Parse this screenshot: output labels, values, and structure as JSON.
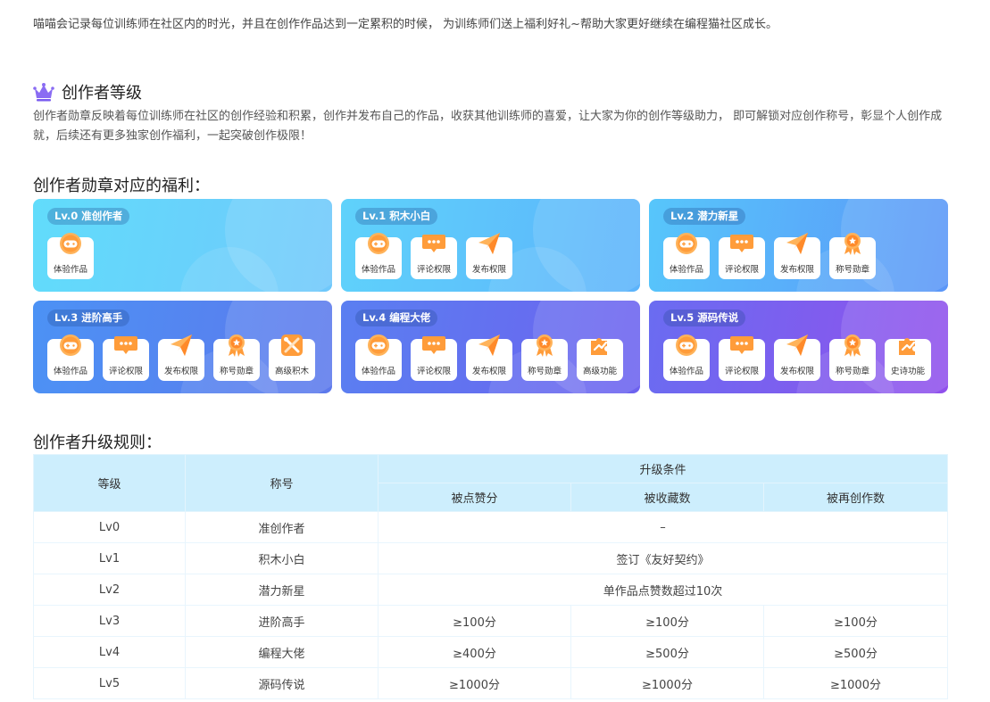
{
  "intro": "喵喵会记录每位训练师在社区内的时光，并且在创作作品达到一定累积的时候， 为训练师们送上福利好礼~帮助大家更好继续在编程猫社区成长。",
  "level_section": {
    "title": "创作者等级",
    "desc": "创作者勋章反映着每位训练师在社区的创作经验和积累，创作并发布自己的作品，收获其他训练师的喜爱，让大家为你的创作等级助力， 即可解锁对应创作称号，彰显个人创作成就，后续还有更多独家创作福利，一起突破创作极限！"
  },
  "benefits_title": "创作者勋章对应的福利：",
  "cards": [
    {
      "badge": "Lv.0  准创作者",
      "perks": [
        {
          "label": "体验作品",
          "icon": "gamepad-icon"
        }
      ]
    },
    {
      "badge": "Lv.1  积木小白",
      "perks": [
        {
          "label": "体验作品",
          "icon": "gamepad-icon"
        },
        {
          "label": "评论权限",
          "icon": "comment-icon"
        },
        {
          "label": "发布权限",
          "icon": "paper-plane-icon"
        }
      ]
    },
    {
      "badge": "Lv.2  潜力新星",
      "perks": [
        {
          "label": "体验作品",
          "icon": "gamepad-icon"
        },
        {
          "label": "评论权限",
          "icon": "comment-icon"
        },
        {
          "label": "发布权限",
          "icon": "paper-plane-icon"
        },
        {
          "label": "称号勋章",
          "icon": "medal-icon"
        }
      ]
    },
    {
      "badge": "Lv.3  进阶高手",
      "perks": [
        {
          "label": "体验作品",
          "icon": "gamepad-icon"
        },
        {
          "label": "评论权限",
          "icon": "comment-icon"
        },
        {
          "label": "发布权限",
          "icon": "paper-plane-icon"
        },
        {
          "label": "称号勋章",
          "icon": "medal-icon"
        },
        {
          "label": "高级积木",
          "icon": "tools-icon"
        }
      ]
    },
    {
      "badge": "Lv.4  编程大佬",
      "perks": [
        {
          "label": "体验作品",
          "icon": "gamepad-icon"
        },
        {
          "label": "评论权限",
          "icon": "comment-icon"
        },
        {
          "label": "发布权限",
          "icon": "paper-plane-icon"
        },
        {
          "label": "称号勋章",
          "icon": "medal-icon"
        },
        {
          "label": "高级功能",
          "icon": "puzzle-icon"
        }
      ]
    },
    {
      "badge": "Lv.5  源码传说",
      "perks": [
        {
          "label": "体验作品",
          "icon": "gamepad-icon"
        },
        {
          "label": "评论权限",
          "icon": "comment-icon"
        },
        {
          "label": "发布权限",
          "icon": "paper-plane-icon"
        },
        {
          "label": "称号勋章",
          "icon": "medal-icon"
        },
        {
          "label": "史诗功能",
          "icon": "puzzle-icon"
        }
      ]
    }
  ],
  "rules_title": "创作者升级规则：",
  "table": {
    "header": {
      "level": "等级",
      "title": "称号",
      "conditions": "升级条件",
      "likes": "被点赞分",
      "favorites": "被收藏数",
      "remixes": "被再创作数"
    },
    "rows": [
      {
        "level": "Lv0",
        "title": "准创作者",
        "merged": "–"
      },
      {
        "level": "Lv1",
        "title": "积木小白",
        "merged": "签订《友好契约》"
      },
      {
        "level": "Lv2",
        "title": "潜力新星",
        "merged": "单作品点赞数超过10次"
      },
      {
        "level": "Lv3",
        "title": "进阶高手",
        "cells": [
          "≥100分",
          "≥100分",
          "≥100分"
        ]
      },
      {
        "level": "Lv4",
        "title": "编程大佬",
        "cells": [
          "≥400分",
          "≥500分",
          "≥500分"
        ]
      },
      {
        "level": "Lv5",
        "title": "源码传说",
        "cells": [
          "≥1000分",
          "≥1000分",
          "≥1000分"
        ]
      }
    ]
  }
}
